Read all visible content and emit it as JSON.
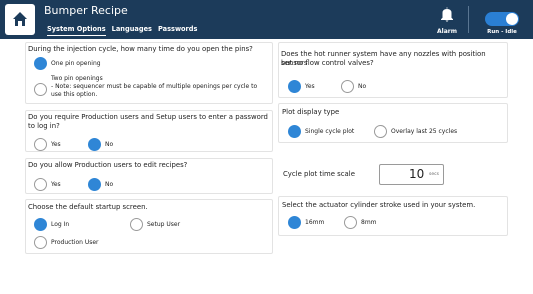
{
  "header": {
    "title": "Bumper Recipe",
    "tabs": [
      {
        "label": "System Options",
        "active": true
      },
      {
        "label": "Languages",
        "active": false
      },
      {
        "label": "Passwords",
        "active": false
      }
    ],
    "alarm_label": "Alarm",
    "run_label": "Run - Idle",
    "run_toggle_on": true,
    "colors": {
      "header_bg": "#1c3b5a",
      "accent": "#2f86d6"
    },
    "icons": [
      "home-icon",
      "bell-icon"
    ]
  },
  "left": {
    "q1": {
      "question": "During the injection cycle, how many time do you open the pins?",
      "options": [
        {
          "label": "One pin opening",
          "selected": true
        },
        {
          "label_line1": "Two pin openings",
          "label_line2": "- Note: sequencer must be capable of multiple openings per cycle to",
          "label_line3": "use this option.",
          "selected": false
        }
      ]
    },
    "q2": {
      "question_line1": "Do you require Production users and Setup users to enter a password",
      "question_line2": "to log in?",
      "options": [
        {
          "label": "Yes",
          "selected": false
        },
        {
          "label": "No",
          "selected": true
        }
      ]
    },
    "q3": {
      "question": "Do you allow Production users to edit recipes?",
      "options": [
        {
          "label": "Yes",
          "selected": false
        },
        {
          "label": "No",
          "selected": true
        }
      ]
    },
    "q4": {
      "question": "Choose the default startup screen.",
      "options": [
        {
          "label": "Log In",
          "selected": true
        },
        {
          "label": "Setup User",
          "selected": false
        },
        {
          "label": "Production User",
          "selected": false
        }
      ]
    }
  },
  "right": {
    "q5": {
      "question_line1": "Does the hot runner system have any nozzles with position sensors",
      "question_line2": "but no flow control valves?",
      "options": [
        {
          "label": "Yes",
          "selected": true
        },
        {
          "label": "No",
          "selected": false
        }
      ]
    },
    "q6": {
      "question": "Plot display type",
      "options": [
        {
          "label": "Single cycle plot",
          "selected": true
        },
        {
          "label": "Overlay last 25 cycles",
          "selected": false
        }
      ]
    },
    "q7": {
      "question": "Cycle plot time scale",
      "value": "10",
      "unit": "secs"
    },
    "q8": {
      "question": "Select the actuator cylinder stroke used in your system.",
      "options": [
        {
          "label": "16mm",
          "selected": true
        },
        {
          "label": "8mm",
          "selected": false
        }
      ]
    }
  }
}
